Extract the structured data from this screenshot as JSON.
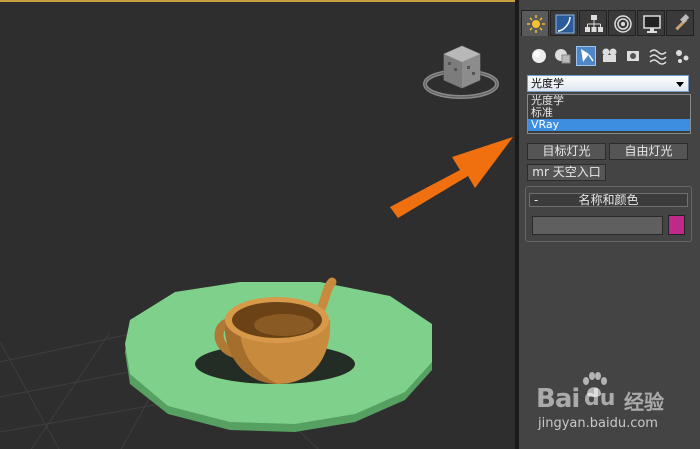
{
  "command_panel": {
    "tabs": [
      {
        "icon": "create-icon"
      },
      {
        "icon": "modify-icon"
      },
      {
        "icon": "hierarchy-icon"
      },
      {
        "icon": "motion-icon"
      },
      {
        "icon": "display-icon"
      },
      {
        "icon": "utilities-icon"
      }
    ],
    "subcategories": [
      "geometry-icon",
      "shapes-icon",
      "lights-icon",
      "cameras-icon",
      "helpers-icon",
      "space-warps-icon",
      "systems-icon"
    ],
    "light_type_dropdown": {
      "selected": "光度学",
      "options": [
        "光度学",
        "标准",
        "VRay"
      ],
      "highlighted": "VRay"
    },
    "buttons": {
      "target_light": "目标灯光",
      "free_light": "自由灯光",
      "sky_portal": "mr 天空入口"
    },
    "name_color_rollout": {
      "toggle": "-",
      "title": "名称和颜色",
      "name_value": "",
      "color": "#c0288a"
    }
  },
  "watermark": {
    "brand": "Bai",
    "brand_suffix": "经验",
    "url": "jingyan.baidu.com"
  },
  "colors": {
    "accent_blue": "#3d8ee0",
    "arrow_orange": "#f07010",
    "plate_green": "#7fd08a",
    "teapot": "#c88a3c"
  }
}
